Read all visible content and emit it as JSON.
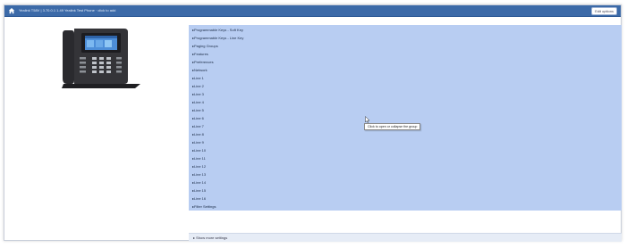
{
  "window": {
    "title": "Yealink T58V | 3.70.0.1 1.49 Yealink Test Phone · click to add",
    "help_label": "Edit options"
  },
  "groups": [
    "▸Programmable Keys - Soft Key",
    "▸Programmable Keys - Line Key",
    "▸Paging Groups",
    "▸Features",
    "▸Preferences",
    "▸Network",
    "▸Line 1",
    "▸Line 2",
    "▸Line 3",
    "▸Line 4",
    "▸Line 5",
    "▸Line 6",
    "▸Line 7",
    "▸Line 8",
    "▸Line 9",
    "▸Line 10",
    "▸Line 11",
    "▸Line 12",
    "▸Line 13",
    "▸Line 14",
    "▸Line 15",
    "▸Line 16",
    "▸Filter Settings"
  ],
  "tooltip": "Click to open or collapse the group",
  "footer": {
    "label": "▸ Show more settings"
  },
  "icons": {
    "home": "home-icon",
    "phone": "desk-phone-image",
    "cursor": "mouse-pointer-icon"
  },
  "colors": {
    "titlebar": "#3c6aa8",
    "group_panel": "#b8cdf2",
    "footer_bar": "#e6ecf6"
  }
}
